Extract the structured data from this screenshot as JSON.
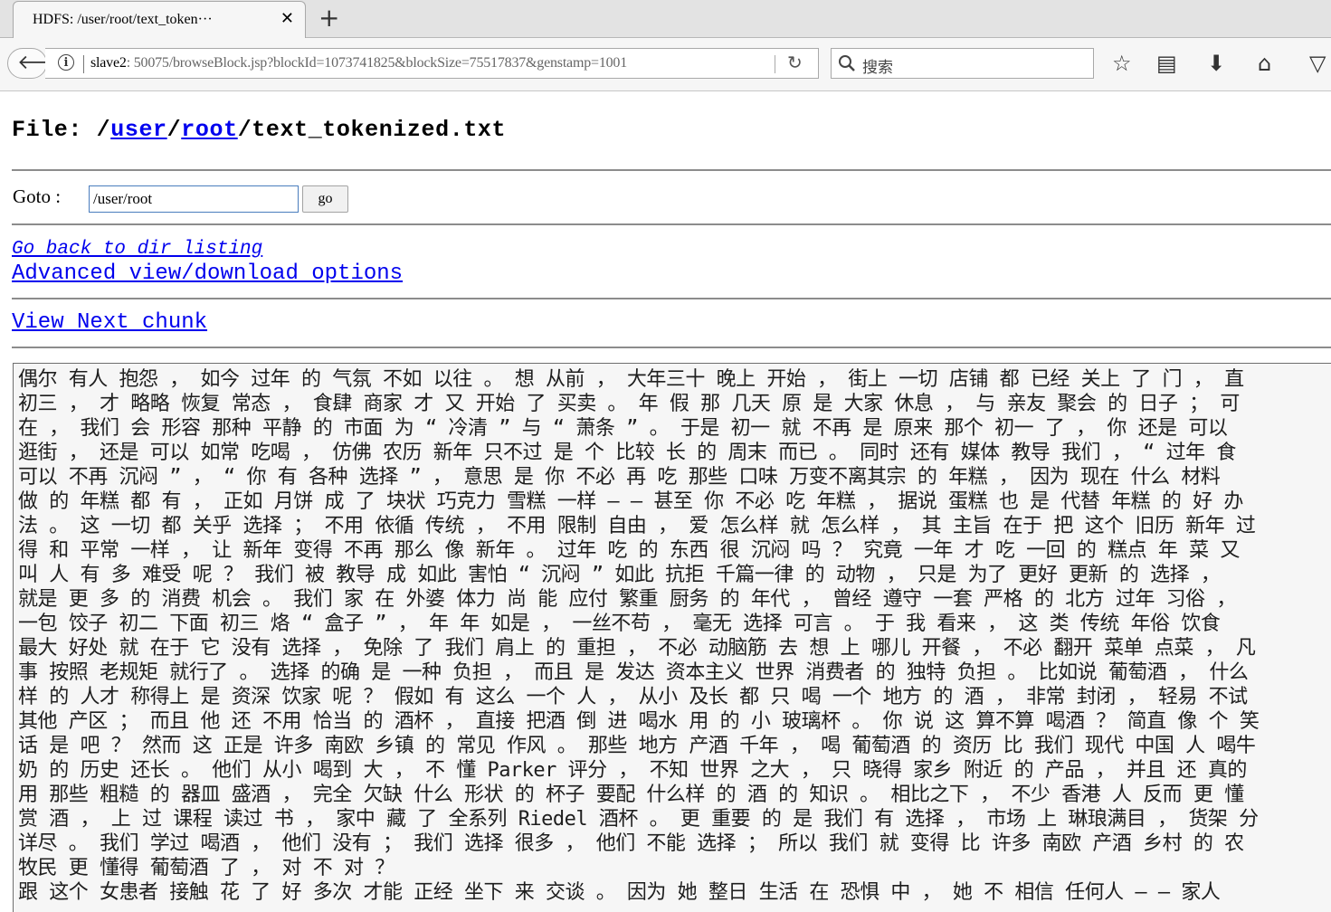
{
  "browser": {
    "tab_title": "HDFS: /user/root/text_token···",
    "url_host": "slave2",
    "url_rest": ": 50075/browseBlock.jsp?blockId=1073741825&blockSize=75517837&genstamp=1001",
    "search_placeholder": "搜索"
  },
  "page": {
    "file_label": "File: ",
    "path_sep": "/",
    "path_user": "user",
    "path_root": "root",
    "path_file": "/text_tokenized.txt",
    "goto_label": "Goto :",
    "goto_value": "/user/root",
    "go_button": "go",
    "back_link": "Go back to dir listing",
    "advanced_link": "Advanced view/download options",
    "next_chunk_link": "View Next chunk"
  },
  "chunk_lines": [
    "偶尔 有人 抱怨 ， 如今 过年 的 气氛 不如 以往 。 想 从前 ， 大年三十 晚上 开始 ， 街上 一切 店铺 都 已经 关上 了 门 ， 直",
    "初三 ， 才 略略 恢复 常态 ， 食肆 商家 才 又 开始 了 买卖 。 年 假 那 几天 原 是 大家 休息 ， 与 亲友 聚会 的 日子 ； 可",
    "在 ， 我们 会 形容 那种 平静 的 市面 为 “ 冷清 ” 与 “ 萧条 ” 。 于是 初一 就 不再 是 原来 那个 初一 了 ， 你 还是 可以",
    "逛街 ， 还是 可以 如常 吃喝 ， 仿佛 农历 新年 只不过 是 个 比较 长 的 周末 而已 。 同时 还有 媒体 教导 我们 ， “ 过年 食",
    "可以 不再 沉闷 ” ， “ 你 有 各种 选择 ” ， 意思 是 你 不必 再 吃 那些 口味 万变不离其宗 的 年糕 ， 因为 现在 什么 材料",
    "做 的 年糕 都 有 ， 正如 月饼 成 了 块状 巧克力 雪糕 一样 — — 甚至 你 不必 吃 年糕 ， 据说 蛋糕 也 是 代替 年糕 的 好 办",
    "法 。 这 一切 都 关乎 选择 ； 不用 依循 传统 ， 不用 限制 自由 ， 爱 怎么样 就 怎么样 ， 其 主旨 在于 把 这个 旧历 新年 过",
    "得 和 平常 一样 ， 让 新年 变得 不再 那么 像 新年 。 过年 吃 的 东西 很 沉闷 吗 ？ 究竟 一年 才 吃 一回 的 糕点 年 菜 又",
    "叫 人 有 多 难受 呢 ？ 我们 被 教导 成 如此 害怕 “ 沉闷 ” 如此 抗拒 千篇一律 的 动物 ， 只是 为了 更好 更新 的 选择 ，",
    "就是 更 多 的 消费 机会 。 我们 家 在 外婆 体力 尚 能 应付 繁重 厨务 的 年代 ， 曾经 遵守 一套 严格 的 北方 过年 习俗 ，",
    "一包 饺子 初二 下面 初三 烙 “ 盒子 ” ， 年 年 如是 ， 一丝不苟 ， 毫无 选择 可言 。 于 我 看来 ， 这 类 传统 年俗 饮食",
    "最大 好处 就 在于 它 没有 选择 ， 免除 了 我们 肩上 的 重担 ， 不必 动脑筋 去 想 上 哪儿 开餐 ， 不必 翻开 菜单 点菜 ， 凡",
    "事 按照 老规矩 就行了 。 选择 的确 是 一种 负担 ， 而且 是 发达 资本主义 世界 消费者 的 独特 负担 。 比如说 葡萄酒 ， 什么",
    "样 的 人才 称得上 是 资深 饮家 呢 ？ 假如 有 这么 一个 人 ， 从小 及长 都 只 喝 一个 地方 的 酒 ， 非常 封闭 ， 轻易 不试",
    "其他 产区 ； 而且 他 还 不用 恰当 的 酒杯 ， 直接 把酒 倒 进 喝水 用 的 小 玻璃杯 。 你 说 这 算不算 喝酒 ？ 简直 像 个 笑",
    "话 是 吧 ？ 然而 这 正是 许多 南欧 乡镇 的 常见 作风 。 那些 地方 产酒 千年 ， 喝 葡萄酒 的 资历 比 我们 现代 中国 人 喝牛",
    "奶 的 历史 还长 。 他们 从小 喝到 大 ， 不 懂 Parker 评分 ， 不知 世界 之大 ， 只 晓得 家乡 附近 的 产品 ， 并且 还 真的",
    "用 那些 粗糙 的 器皿 盛酒 ， 完全 欠缺 什么 形状 的 杯子 要配 什么样 的 酒 的 知识 。 相比之下 ， 不少 香港 人 反而 更 懂",
    "赏 酒 ， 上 过 课程 读过 书 ， 家中 藏 了 全系列 Riedel 酒杯 。 更 重要 的 是 我们 有 选择 ， 市场 上 琳琅满目 ， 货架 分",
    "详尽 。 我们 学过 喝酒 ， 他们 没有 ； 我们 选择 很多 ， 他们 不能 选择 ； 所以 我们 就 变得 比 许多 南欧 产酒 乡村 的 农",
    "牧民 更 懂得 葡萄酒 了 ， 对 不 对 ？",
    "跟 这个 女患者 接触 花 了 好 多次 才能 正经 坐下 来 交谈 。 因为 她 整日 生活 在 恐惧 中 ， 她 不 相信 任何人 — — 家人"
  ]
}
